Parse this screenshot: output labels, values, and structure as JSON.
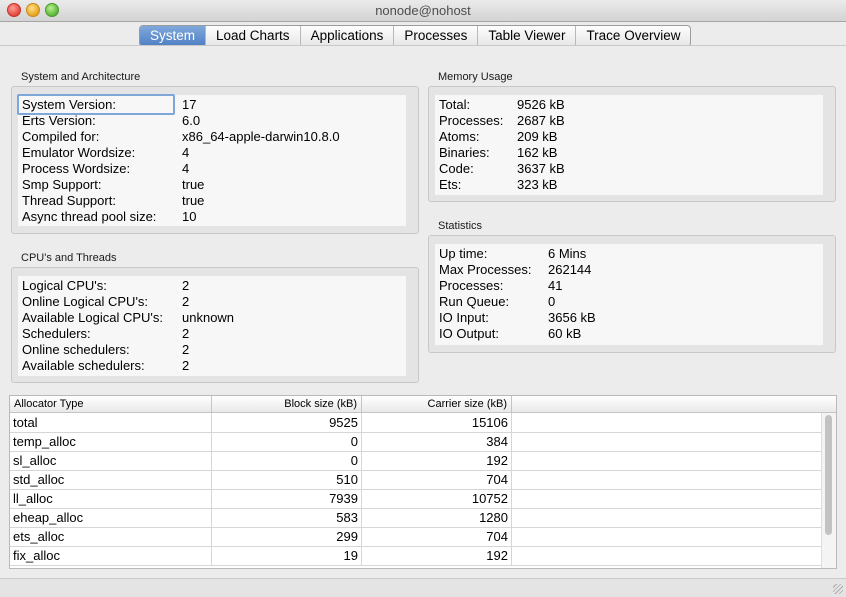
{
  "window": {
    "title": "nonode@nohost"
  },
  "tabs": [
    {
      "label": "System",
      "active": true
    },
    {
      "label": "Load Charts",
      "active": false
    },
    {
      "label": "Applications",
      "active": false
    },
    {
      "label": "Processes",
      "active": false
    },
    {
      "label": "Table Viewer",
      "active": false
    },
    {
      "label": "Trace Overview",
      "active": false
    }
  ],
  "system": {
    "title": "System and Architecture",
    "rows": [
      {
        "k": "System Version:",
        "v": "17"
      },
      {
        "k": "Erts Version:",
        "v": "6.0"
      },
      {
        "k": "Compiled for:",
        "v": "x86_64-apple-darwin10.8.0"
      },
      {
        "k": "Emulator Wordsize:",
        "v": "4"
      },
      {
        "k": "Process Wordsize:",
        "v": "4"
      },
      {
        "k": "Smp Support:",
        "v": "true"
      },
      {
        "k": "Thread Support:",
        "v": "true"
      },
      {
        "k": "Async thread pool size:",
        "v": "10"
      }
    ]
  },
  "cpu": {
    "title": "CPU's and Threads",
    "rows": [
      {
        "k": "Logical CPU's:",
        "v": "2"
      },
      {
        "k": "Online Logical CPU's:",
        "v": "2"
      },
      {
        "k": "Available Logical CPU's:",
        "v": "unknown"
      },
      {
        "k": "Schedulers:",
        "v": "2"
      },
      {
        "k": "Online schedulers:",
        "v": "2"
      },
      {
        "k": "Available schedulers:",
        "v": "2"
      }
    ]
  },
  "memory": {
    "title": "Memory Usage",
    "rows": [
      {
        "k": "Total:",
        "v": "9526 kB"
      },
      {
        "k": "Processes:",
        "v": "2687 kB"
      },
      {
        "k": "Atoms:",
        "v": "209 kB"
      },
      {
        "k": "Binaries:",
        "v": "162 kB"
      },
      {
        "k": "Code:",
        "v": "3637 kB"
      },
      {
        "k": "Ets:",
        "v": "323 kB"
      }
    ]
  },
  "statistics": {
    "title": "Statistics",
    "rows": [
      {
        "k": "Up time:",
        "v": "6 Mins"
      },
      {
        "k": "Max Processes:",
        "v": "262144"
      },
      {
        "k": "Processes:",
        "v": "41"
      },
      {
        "k": "Run Queue:",
        "v": "0"
      },
      {
        "k": "IO Input:",
        "v": "3656 kB"
      },
      {
        "k": "IO Output:",
        "v": "60 kB"
      }
    ]
  },
  "alloc_table": {
    "columns": [
      "Allocator Type",
      "Block size (kB)",
      "Carrier size (kB)"
    ],
    "rows": [
      [
        "total",
        "9525",
        "15106"
      ],
      [
        "temp_alloc",
        "0",
        "384"
      ],
      [
        "sl_alloc",
        "0",
        "192"
      ],
      [
        "std_alloc",
        "510",
        "704"
      ],
      [
        "ll_alloc",
        "7939",
        "10752"
      ],
      [
        "eheap_alloc",
        "583",
        "1280"
      ],
      [
        "ets_alloc",
        "299",
        "704"
      ],
      [
        "fix_alloc",
        "19",
        "192"
      ]
    ]
  }
}
